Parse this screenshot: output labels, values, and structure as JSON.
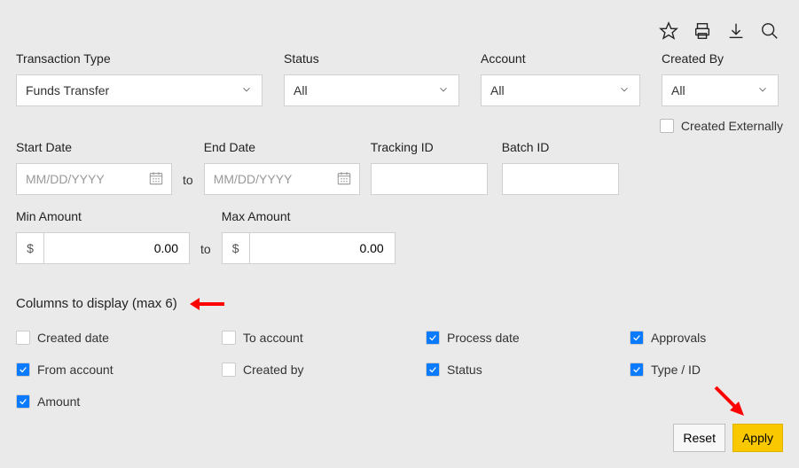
{
  "toolbar_icons": [
    "star-icon",
    "print-icon",
    "download-icon",
    "search-icon"
  ],
  "filters": {
    "transaction_type": {
      "label": "Transaction Type",
      "value": "Funds Transfer"
    },
    "status": {
      "label": "Status",
      "value": "All"
    },
    "account": {
      "label": "Account",
      "value": "All"
    },
    "created_by": {
      "label": "Created By",
      "value": "All"
    },
    "created_externally": {
      "label": "Created Externally",
      "checked": false
    },
    "start_date": {
      "label": "Start Date",
      "placeholder": "MM/DD/YYYY",
      "value": ""
    },
    "end_date": {
      "label": "End Date",
      "placeholder": "MM/DD/YYYY",
      "value": ""
    },
    "date_separator": "to",
    "tracking_id": {
      "label": "Tracking ID",
      "value": ""
    },
    "batch_id": {
      "label": "Batch ID",
      "value": ""
    },
    "min_amount": {
      "label": "Min Amount",
      "currency": "$",
      "value": "0.00"
    },
    "max_amount": {
      "label": "Max Amount",
      "currency": "$",
      "value": "0.00"
    },
    "amount_separator": "to"
  },
  "columns": {
    "title": "Columns to display (max 6)",
    "items": [
      {
        "label": "Created date",
        "checked": false
      },
      {
        "label": "To account",
        "checked": false
      },
      {
        "label": "Process date",
        "checked": true
      },
      {
        "label": "Approvals",
        "checked": true
      },
      {
        "label": "From account",
        "checked": true
      },
      {
        "label": "Created by",
        "checked": false
      },
      {
        "label": "Status",
        "checked": true
      },
      {
        "label": "Type / ID",
        "checked": true
      },
      {
        "label": "Amount",
        "checked": true
      }
    ]
  },
  "buttons": {
    "reset": "Reset",
    "apply": "Apply"
  },
  "annotations": {
    "arrow_points_to_columns_title": true,
    "arrow_points_to_apply_button": true,
    "arrow_color": "#ff0000"
  }
}
